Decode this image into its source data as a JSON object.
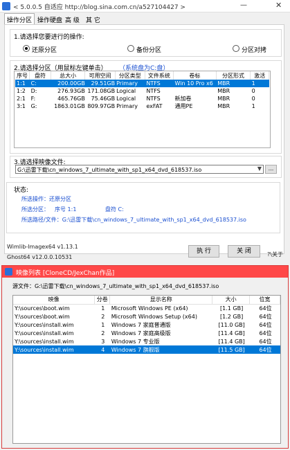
{
  "window": {
    "title": "< 5.0.0.5 自适应 http://blog.sina.com.cn/a527104427 >",
    "minimize": "—",
    "close": "✕"
  },
  "tabs": [
    "操作分区",
    "操作硬盘",
    "高 级",
    "其 它"
  ],
  "step1": {
    "title": "1.请选择您要进行的操作:",
    "options": [
      "还原分区",
      "备份分区",
      "分区对拷"
    ],
    "selected": "还原分区"
  },
  "step2": {
    "title": "2.请选择分区（用鼠标左键单击）",
    "system_note": "（系统盘为C:盘）",
    "columns": [
      "序号",
      "盘符",
      "总大小",
      "可用空间",
      "分区类型",
      "文件系统",
      "卷标",
      "分区形式",
      "激活"
    ],
    "rows": [
      [
        "1:1",
        "C:",
        "200.00GB",
        "29.51GB",
        "Primary",
        "NTFS",
        "Win 10 Pro x6",
        "MBR",
        "1"
      ],
      [
        "1:2",
        "D:",
        "276.93GB",
        "171.08GB",
        "Logical",
        "NTFS",
        "",
        "MBR",
        "0"
      ],
      [
        "2:1",
        "F:",
        "465.76GB",
        "75.46GB",
        "Logical",
        "NTFS",
        "新加卷",
        "MBR",
        "0"
      ],
      [
        "3:1",
        "G:",
        "1863.01GB",
        "809.97GB",
        "Primary",
        "exFAT",
        "通用PE",
        "MBR",
        "1"
      ]
    ],
    "selected_row": 0
  },
  "step3": {
    "title": "3.请选择映像文件:",
    "file": "G:\\迅雷下载\\cn_windows_7_ultimate_with_sp1_x64_dvd_618537.iso",
    "browse": "..."
  },
  "status": {
    "title": "状态:",
    "operation": "所选操作：还原分区",
    "partition_label": "所选分区：",
    "partition_index": "序号 1:1",
    "partition_drive": "盘符 C:",
    "path": "所选路径/文件：G:\\迅雷下载\\cn_windows_7_ultimate_with_sp1_x64_dvd_618537.iso"
  },
  "footer": {
    "wimlib": "Wimlib-Imagex64 v1.13.1",
    "ghost": "Ghost64 v12.0.0.10531",
    "execute": "执 行",
    "close": "关 闭",
    "about": "?\\关于"
  },
  "image_window": {
    "title": "映像列表 [CloneCD/JexChan作品]",
    "source": "源文件：G:\\迅雷下载\\cn_windows_7_ultimate_with_sp1_x64_dvd_618537.iso",
    "columns": [
      "映像",
      "分卷",
      "显示名称",
      "大小",
      "位宽"
    ],
    "rows": [
      [
        "Y:\\sources\\boot.wim",
        "1",
        "Microsoft Windows PE (x64)",
        "[1.1 GB]",
        "64位"
      ],
      [
        "Y:\\sources\\boot.wim",
        "2",
        "Microsoft Windows Setup (x64)",
        "[1.2 GB]",
        "64位"
      ],
      [
        "Y:\\sources\\install.wim",
        "1",
        "Windows 7 家庭普通版",
        "[11.0 GB]",
        "64位"
      ],
      [
        "Y:\\sources\\install.wim",
        "2",
        "Windows 7 家庭高级版",
        "[11.4 GB]",
        "64位"
      ],
      [
        "Y:\\sources\\install.wim",
        "3",
        "Windows 7 专业版",
        "[11.4 GB]",
        "64位"
      ],
      [
        "Y:\\sources\\install.wim",
        "4",
        "Windows 7 旗舰版",
        "[11.5 GB]",
        "64位"
      ]
    ],
    "selected_row": 5
  }
}
